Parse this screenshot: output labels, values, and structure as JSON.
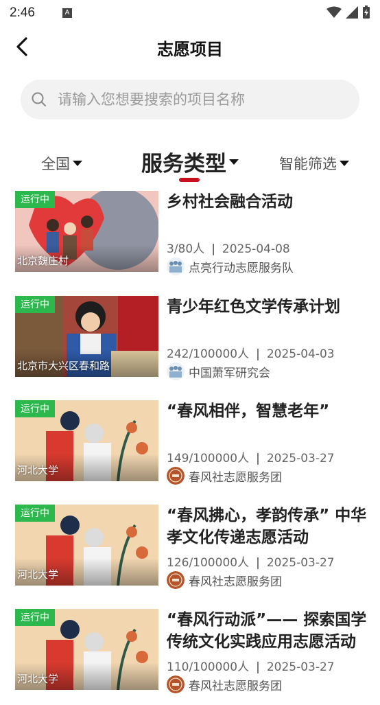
{
  "status": {
    "time": "2:46"
  },
  "header": {
    "title": "志愿项目"
  },
  "search": {
    "placeholder": "请输入您想要搜索的项目名称"
  },
  "filters": {
    "region": "全国",
    "service_type": "服务类型",
    "smart": "智能筛选"
  },
  "projects": [
    {
      "badge": "运行中",
      "place": "北京魏庄村",
      "title": "乡村社会融合活动",
      "count": "3/80人",
      "date": "2025-04-08",
      "org": "点亮行动志愿服务队",
      "logo": "volunteers-icon"
    },
    {
      "badge": "运行中",
      "place": "北京市大兴区春和路",
      "title": "青少年红色文学传承计划",
      "count": "242/100000人",
      "date": "2025-04-03",
      "org": "中国萧军研究会",
      "logo": "volunteers-icon"
    },
    {
      "badge": "运行中",
      "place": "河北大学",
      "title": "“春风相伴，智慧老年”",
      "count": "149/100000人",
      "date": "2025-03-27",
      "org": "春风社志愿服务团",
      "logo": "seal-logo"
    },
    {
      "badge": "运行中",
      "place": "河北大学",
      "title": "“春风拂心，孝韵传承” 中华孝文化传递志愿活动",
      "count": "126/100000人",
      "date": "2025-03-27",
      "org": "春风社志愿服务团",
      "logo": "seal-logo"
    },
    {
      "badge": "运行中",
      "place": "河北大学",
      "title": "“春风行动派”—— 探索国学传统文化实践应用志愿活动",
      "count": "110/100000人",
      "date": "2025-03-27",
      "org": "春风社志愿服务团",
      "logo": "seal-logo"
    }
  ]
}
